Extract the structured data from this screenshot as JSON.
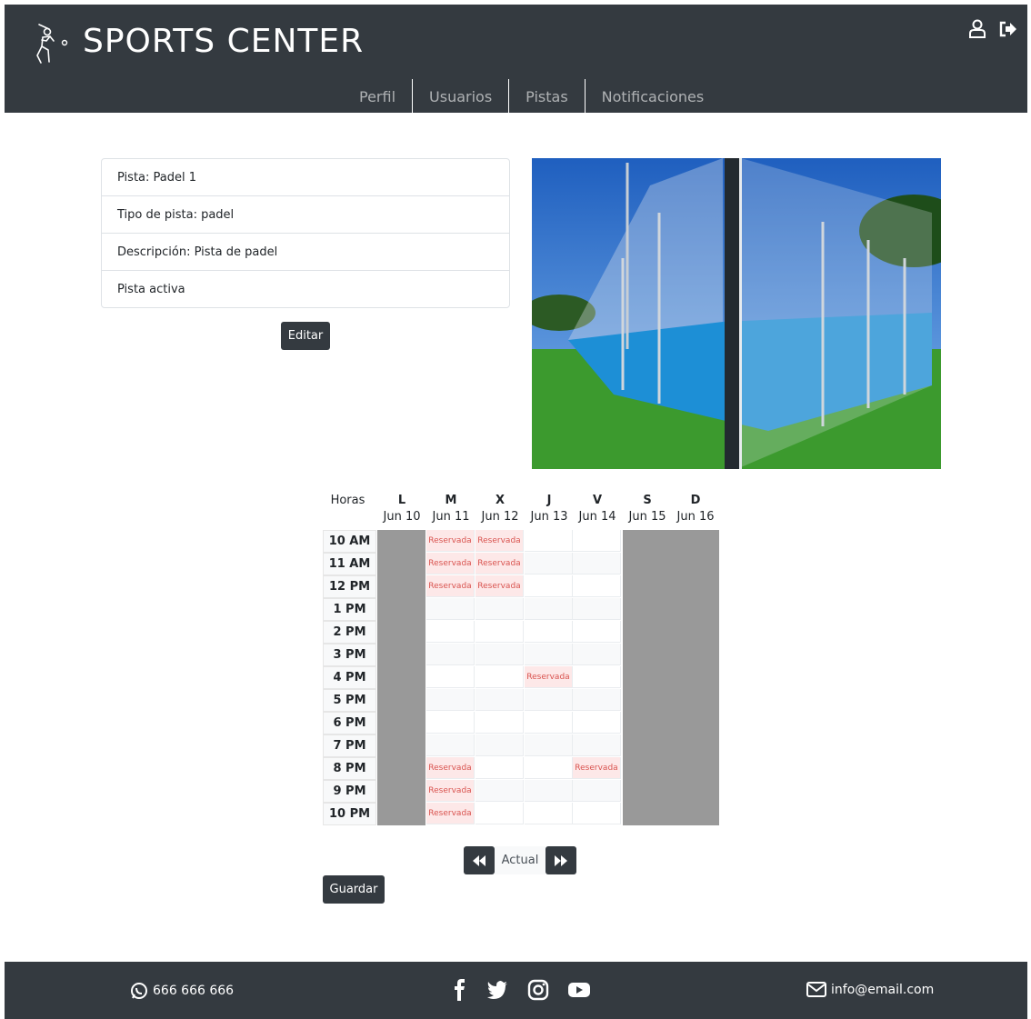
{
  "header": {
    "brand": "SPORTS CENTER",
    "icons": [
      "baseball-player-icon",
      "user-icon",
      "logout-icon"
    ],
    "nav": [
      {
        "label": "Perfil"
      },
      {
        "label": "Usuarios"
      },
      {
        "label": "Pistas"
      },
      {
        "label": "Notificaciones"
      }
    ]
  },
  "court": {
    "rows": [
      "Pista: Padel 1",
      "Tipo de pista: padel",
      "Descripción: Pista de padel",
      "Pista activa"
    ],
    "edit_label": "Editar"
  },
  "calendar": {
    "hours_label": "Horas",
    "days": [
      {
        "letter": "L",
        "date": "Jun 10"
      },
      {
        "letter": "M",
        "date": "Jun 11"
      },
      {
        "letter": "X",
        "date": "Jun 12"
      },
      {
        "letter": "J",
        "date": "Jun 13"
      },
      {
        "letter": "V",
        "date": "Jun 14"
      },
      {
        "letter": "S",
        "date": "Jun 15"
      },
      {
        "letter": "D",
        "date": "Jun 16"
      }
    ],
    "hours": [
      "10 AM",
      "11 AM",
      "12 PM",
      "1 PM",
      "2 PM",
      "3 PM",
      "4 PM",
      "5 PM",
      "6 PM",
      "7 PM",
      "8 PM",
      "9 PM",
      "10 PM"
    ],
    "reserved_label": "Reservada",
    "closed_days": [
      0,
      5,
      6
    ],
    "reserved": [
      [
        1,
        0
      ],
      [
        2,
        0
      ],
      [
        1,
        1
      ],
      [
        2,
        1
      ],
      [
        1,
        2
      ],
      [
        2,
        2
      ],
      [
        3,
        6
      ],
      [
        1,
        10
      ],
      [
        4,
        10
      ],
      [
        1,
        11
      ],
      [
        1,
        12
      ]
    ],
    "pager": {
      "current_label": "Actual"
    },
    "save_label": "Guardar"
  },
  "footer": {
    "phone": "666 666 666",
    "email": "info@email.com",
    "social": [
      "facebook-icon",
      "twitter-icon",
      "instagram-icon",
      "youtube-icon"
    ]
  }
}
